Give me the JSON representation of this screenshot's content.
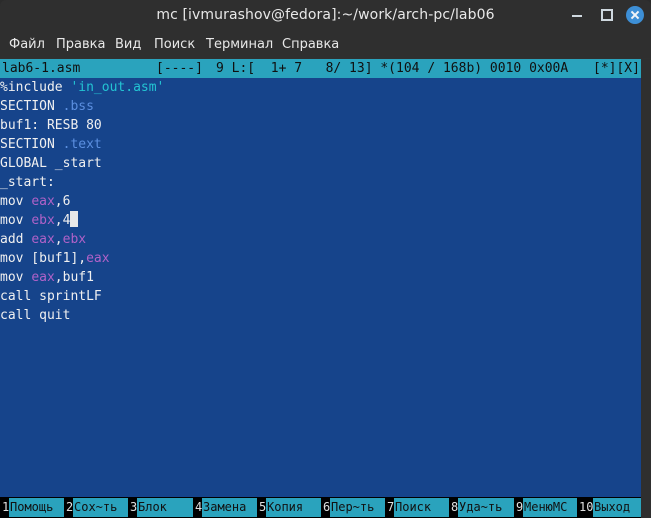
{
  "window": {
    "title": "mc [ivmurashov@fedora]:~/work/arch-pc/lab06"
  },
  "menu": [
    "Файл",
    "Правка",
    "Вид",
    "Поиск",
    "Терминал",
    "Справка"
  ],
  "editor": {
    "status": {
      "filename": "lab6-1.asm",
      "flags": "[----]",
      "position": "9 L:[  1+ 7   8/ 13] *(104 / 168b) 0010 0x00A",
      "controls": "[*][X]"
    },
    "lines": [
      [
        {
          "t": "%include "
        },
        {
          "t": "'in_out.asm'",
          "c": "str"
        }
      ],
      [
        {
          "t": "SECTION "
        },
        {
          "t": ".bss",
          "c": "sec"
        }
      ],
      [
        {
          "t": "buf1: RESB 80"
        }
      ],
      [
        {
          "t": "SECTION "
        },
        {
          "t": ".text",
          "c": "sec"
        }
      ],
      [
        {
          "t": "GLOBAL _start"
        }
      ],
      [
        {
          "t": "_start:"
        }
      ],
      [
        {
          "t": "mov "
        },
        {
          "t": "eax",
          "c": "reg"
        },
        {
          "t": ",6"
        }
      ],
      [
        {
          "t": "mov "
        },
        {
          "t": "ebx",
          "c": "reg"
        },
        {
          "t": ",4"
        },
        {
          "t": "",
          "c": "cursor"
        }
      ],
      [
        {
          "t": "add "
        },
        {
          "t": "eax",
          "c": "reg"
        },
        {
          "t": ","
        },
        {
          "t": "ebx",
          "c": "reg"
        }
      ],
      [
        {
          "t": "mov [buf1],"
        },
        {
          "t": "eax",
          "c": "reg"
        }
      ],
      [
        {
          "t": "mov "
        },
        {
          "t": "eax",
          "c": "reg"
        },
        {
          "t": ",buf1"
        }
      ],
      [
        {
          "t": "call sprintLF"
        }
      ],
      [
        {
          "t": "call quit"
        }
      ]
    ]
  },
  "fkeys": [
    {
      "num": "1",
      "label": "Помощь"
    },
    {
      "num": "2",
      "label": "Сох~ть"
    },
    {
      "num": "3",
      "label": "Блок"
    },
    {
      "num": "4",
      "label": "Замена"
    },
    {
      "num": "5",
      "label": "Копия"
    },
    {
      "num": "6",
      "label": "Пер~ть"
    },
    {
      "num": "7",
      "label": "Поиск"
    },
    {
      "num": "8",
      "label": "Уда~ть"
    },
    {
      "num": "9",
      "label": "МенюMC"
    },
    {
      "num": "10",
      "label": "Выход"
    }
  ],
  "colors": {
    "terminal_bg": "#16448b",
    "status_bg": "#2aa3bd",
    "string": "#23c4d3",
    "section": "#5b8fe0",
    "register": "#b062c8"
  }
}
